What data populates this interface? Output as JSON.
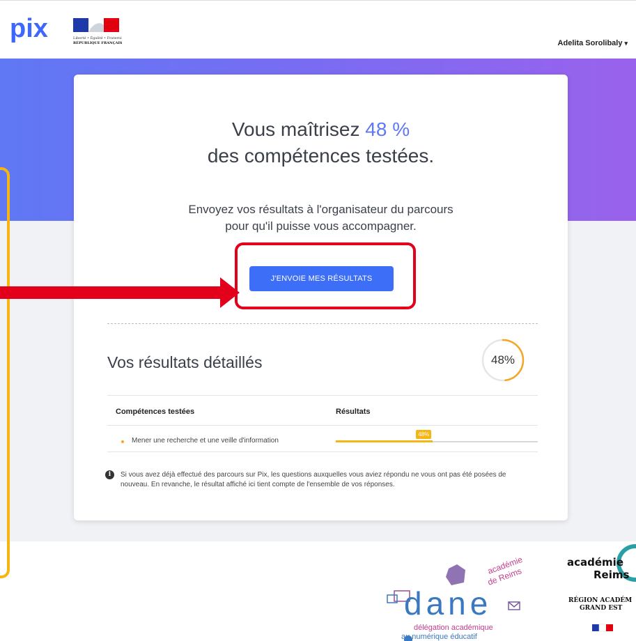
{
  "header": {
    "logo": "pix",
    "republic_line1": "Liberté • Égalité • Fraternité",
    "republic_line2": "RÉPUBLIQUE FRANÇAISE",
    "user_name": "Adelita Sorolibaly"
  },
  "result": {
    "line1_prefix": "Vous maîtrisez",
    "percent": "48 %",
    "line2": "des compétences testées.",
    "message_line1": "Envoyez vos résultats à l'organisateur du parcours",
    "message_line2": "pour qu'il puisse vous accompagner.",
    "send_button": "J'ENVOIE MES RÉSULTATS"
  },
  "details": {
    "title": "Vos résultats détaillés",
    "gauge_label": "48%",
    "gauge_value": 0.48,
    "columns": [
      "Compétences testées",
      "Résultats"
    ],
    "rows": [
      {
        "competence": "Mener une recherche et une veille d'information",
        "badge": "48%",
        "value": 0.48
      }
    ],
    "info_line1": "Si vous avez déjà effectué des parcours sur Pix, les questions auxquelles vous aviez répondu ne vous ont pas été posées de",
    "info_line2": "nouveau. En revanche, le résultat affiché ici tient compte de l'ensemble de vos réponses."
  },
  "footer": {
    "dane_word": "dane",
    "dane_academie": "académie",
    "dane_reims": "de Reims",
    "dane_line1": "délégation académique",
    "dane_line2": "au numérique éducatif",
    "academie_word": "académie",
    "reims_word": "Reims",
    "region_line1": "RÉGION ACADÉM",
    "region_line2": "GRAND EST"
  },
  "colors": {
    "accent": "#5f78f4",
    "button": "#3c6ef7",
    "progress": "#f5b512",
    "annotation_red": "#e3001b",
    "annotation_yellow": "#f6b511"
  }
}
